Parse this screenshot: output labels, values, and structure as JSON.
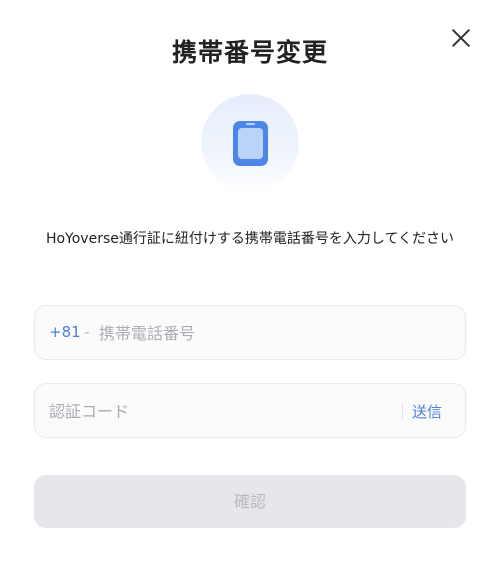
{
  "dialog": {
    "title": "携帯番号変更",
    "description": "HoYoverse通行証に紐付けする携帯電話番号を入力してください"
  },
  "icons": {
    "close": "close-icon",
    "phone": "phone-icon"
  },
  "phone_field": {
    "country_code": "+81",
    "separator": "-",
    "value": "",
    "placeholder": "携帯電話番号"
  },
  "code_field": {
    "value": "",
    "placeholder": "認証コード",
    "send_label": "送信"
  },
  "confirm_button": {
    "label": "確認"
  },
  "colors": {
    "accent": "#4a7fe0",
    "icon_blue": "#4d86e8",
    "disabled_button_bg": "#e6e7eb",
    "disabled_button_text": "#b7b9bf"
  }
}
